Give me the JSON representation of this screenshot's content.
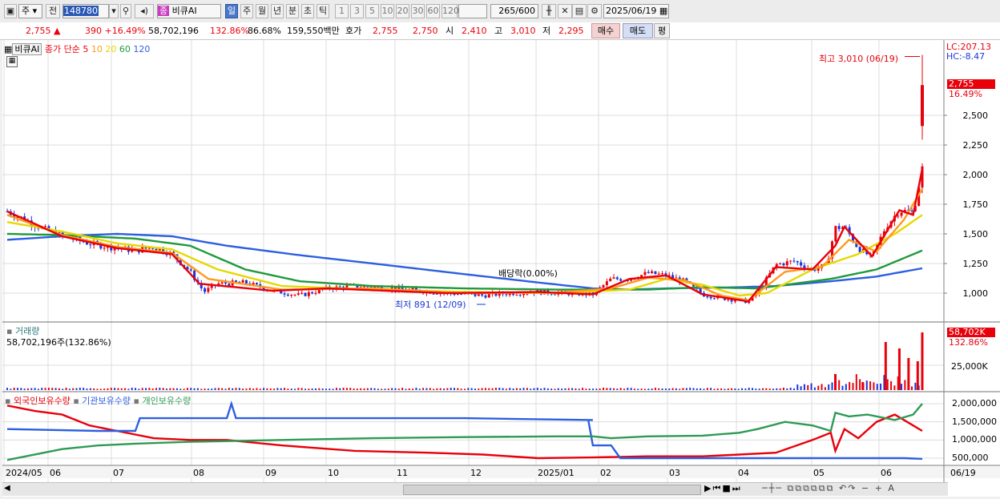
{
  "toolbar": {
    "market": "주",
    "prev_label": "전",
    "code": "148780",
    "stock_badge": "종",
    "stock_name": "비큐AI",
    "periods": [
      "일",
      "주",
      "월",
      "년",
      "분",
      "초",
      "틱"
    ],
    "intervals": [
      "1",
      "3",
      "5",
      "10",
      "20",
      "30",
      "60",
      "120"
    ],
    "count": "265",
    "count_total": "/600",
    "date": "2025/06/19"
  },
  "info": {
    "price": "2,755 ▲",
    "change": "390 +16.49%",
    "volume": "58,702,196",
    "vol_ratio": "132.86%",
    "turnover": "86.68%",
    "amount": "159,550백만",
    "quote_label": "호가",
    "ask": "2,755",
    "bid": "2,750",
    "open_label": "시",
    "open": "2,410",
    "high_label": "고",
    "high": "3,010",
    "low_label": "저",
    "low": "2,295",
    "buy_label": "매수",
    "sell_label": "매도",
    "eval_label": "평"
  },
  "legend": {
    "name": "비큐AI",
    "ma_title": "종가 단순",
    "ma": [
      {
        "label": "5",
        "color": "#e8000b"
      },
      {
        "label": "10",
        "color": "#ff9a1c"
      },
      {
        "label": "20",
        "color": "#e6d800"
      },
      {
        "label": "60",
        "color": "#1f9a3a"
      },
      {
        "label": "120",
        "color": "#2d5fe0"
      }
    ]
  },
  "annotations": {
    "high": "최고 3,010 (06/19)",
    "low": "최저 891 (12/09)",
    "dividend": "배당락(0.00%)",
    "lc": "LC:207.13",
    "hc": "HC:-8.47",
    "last_price": "2,755",
    "last_pct": "16.49%"
  },
  "volume_panel": {
    "title": "거래량",
    "value": "58,702,196주(132.86%)",
    "last": "58,702K",
    "last_pct": "132.86%",
    "tick": "25,000K"
  },
  "holdings_panel": {
    "series": [
      {
        "label": "외국인보유수량",
        "color": "#e8000b"
      },
      {
        "label": "기관보유수량",
        "color": "#2d5fe0"
      },
      {
        "label": "개인보유수량",
        "color": "#2e9a55"
      }
    ],
    "ticks": [
      "2,000,000",
      "1,500,000",
      "1,000,000",
      "500,000"
    ]
  },
  "x_axis": {
    "labels": [
      "2024/05",
      "06",
      "07",
      "08",
      "09",
      "10",
      "11",
      "12",
      "2025/01",
      "02",
      "03",
      "04",
      "05",
      "06"
    ],
    "last": "06/19"
  },
  "chart_data": {
    "type": "candlestick",
    "y_ticks": [
      1000,
      1250,
      1500,
      1750,
      2000,
      2250,
      2500
    ],
    "ylim": [
      800,
      3050
    ],
    "x_range": [
      "2024/05",
      "2025/06/19"
    ],
    "last_price": 2755,
    "high": {
      "value": 3010,
      "date": "06/19"
    },
    "low": {
      "value": 891,
      "date": "12/09"
    },
    "close_profile": [
      [
        0,
        1690
      ],
      [
        0.02,
        1620
      ],
      [
        0.04,
        1540
      ],
      [
        0.06,
        1480
      ],
      [
        0.09,
        1420
      ],
      [
        0.12,
        1380
      ],
      [
        0.14,
        1360
      ],
      [
        0.16,
        1390
      ],
      [
        0.18,
        1330
      ],
      [
        0.2,
        1180
      ],
      [
        0.215,
        1010
      ],
      [
        0.23,
        1080
      ],
      [
        0.26,
        1090
      ],
      [
        0.29,
        1020
      ],
      [
        0.32,
        980
      ],
      [
        0.35,
        1040
      ],
      [
        0.38,
        1060
      ],
      [
        0.42,
        1040
      ],
      [
        0.45,
        1020
      ],
      [
        0.48,
        1000
      ],
      [
        0.5,
        990
      ],
      [
        0.52,
        980
      ],
      [
        0.55,
        1000
      ],
      [
        0.58,
        1010
      ],
      [
        0.61,
        1000
      ],
      [
        0.64,
        990
      ],
      [
        0.66,
        1120
      ],
      [
        0.68,
        1120
      ],
      [
        0.7,
        1170
      ],
      [
        0.72,
        1150
      ],
      [
        0.74,
        1100
      ],
      [
        0.76,
        990
      ],
      [
        0.78,
        960
      ],
      [
        0.8,
        940
      ],
      [
        0.81,
        930
      ],
      [
        0.82,
        1000
      ],
      [
        0.83,
        1120
      ],
      [
        0.84,
        1240
      ],
      [
        0.86,
        1270
      ],
      [
        0.88,
        1200
      ],
      [
        0.895,
        1230
      ],
      [
        0.905,
        1550
      ],
      [
        0.915,
        1560
      ],
      [
        0.93,
        1380
      ],
      [
        0.945,
        1300
      ],
      [
        0.96,
        1560
      ],
      [
        0.975,
        1700
      ],
      [
        0.99,
        1680
      ],
      [
        1.0,
        2050
      ],
      [
        1.0,
        2755
      ]
    ],
    "moving_averages": {
      "ma5": [
        [
          0,
          1690
        ],
        [
          0.06,
          1480
        ],
        [
          0.12,
          1380
        ],
        [
          0.18,
          1330
        ],
        [
          0.21,
          1080
        ],
        [
          0.29,
          1020
        ],
        [
          0.35,
          1040
        ],
        [
          0.48,
          1000
        ],
        [
          0.58,
          1010
        ],
        [
          0.64,
          990
        ],
        [
          0.68,
          1120
        ],
        [
          0.72,
          1150
        ],
        [
          0.76,
          990
        ],
        [
          0.81,
          930
        ],
        [
          0.84,
          1220
        ],
        [
          0.88,
          1200
        ],
        [
          0.905,
          1400
        ],
        [
          0.915,
          1560
        ],
        [
          0.945,
          1310
        ],
        [
          0.975,
          1700
        ],
        [
          0.99,
          1660
        ],
        [
          1.0,
          2050
        ]
      ],
      "ma10": [
        [
          0,
          1660
        ],
        [
          0.06,
          1490
        ],
        [
          0.12,
          1390
        ],
        [
          0.18,
          1340
        ],
        [
          0.22,
          1120
        ],
        [
          0.3,
          1030
        ],
        [
          0.4,
          1040
        ],
        [
          0.5,
          1000
        ],
        [
          0.6,
          1005
        ],
        [
          0.66,
          1040
        ],
        [
          0.7,
          1130
        ],
        [
          0.74,
          1110
        ],
        [
          0.78,
          980
        ],
        [
          0.81,
          940
        ],
        [
          0.85,
          1180
        ],
        [
          0.89,
          1220
        ],
        [
          0.92,
          1450
        ],
        [
          0.95,
          1350
        ],
        [
          0.98,
          1620
        ],
        [
          1.0,
          1880
        ]
      ],
      "ma20": [
        [
          0,
          1600
        ],
        [
          0.06,
          1520
        ],
        [
          0.12,
          1420
        ],
        [
          0.18,
          1370
        ],
        [
          0.23,
          1200
        ],
        [
          0.3,
          1060
        ],
        [
          0.4,
          1030
        ],
        [
          0.5,
          1010
        ],
        [
          0.6,
          1000
        ],
        [
          0.68,
          1030
        ],
        [
          0.72,
          1120
        ],
        [
          0.76,
          1070
        ],
        [
          0.8,
          980
        ],
        [
          0.83,
          1000
        ],
        [
          0.88,
          1200
        ],
        [
          0.93,
          1330
        ],
        [
          0.97,
          1500
        ],
        [
          1.0,
          1660
        ]
      ],
      "ma60": [
        [
          0,
          1500
        ],
        [
          0.06,
          1490
        ],
        [
          0.14,
          1460
        ],
        [
          0.2,
          1400
        ],
        [
          0.26,
          1200
        ],
        [
          0.32,
          1100
        ],
        [
          0.4,
          1060
        ],
        [
          0.5,
          1040
        ],
        [
          0.6,
          1030
        ],
        [
          0.7,
          1030
        ],
        [
          0.76,
          1050
        ],
        [
          0.82,
          1040
        ],
        [
          0.86,
          1080
        ],
        [
          0.9,
          1120
        ],
        [
          0.95,
          1200
        ],
        [
          1.0,
          1360
        ]
      ],
      "ma120": [
        [
          0,
          1450
        ],
        [
          0.06,
          1480
        ],
        [
          0.12,
          1500
        ],
        [
          0.18,
          1480
        ],
        [
          0.24,
          1400
        ],
        [
          0.32,
          1320
        ],
        [
          0.4,
          1250
        ],
        [
          0.5,
          1160
        ],
        [
          0.58,
          1090
        ],
        [
          0.64,
          1040
        ],
        [
          0.68,
          1030
        ],
        [
          0.72,
          1040
        ],
        [
          0.8,
          1050
        ],
        [
          0.84,
          1060
        ],
        [
          0.9,
          1100
        ],
        [
          0.95,
          1140
        ],
        [
          1.0,
          1210
        ]
      ]
    }
  }
}
